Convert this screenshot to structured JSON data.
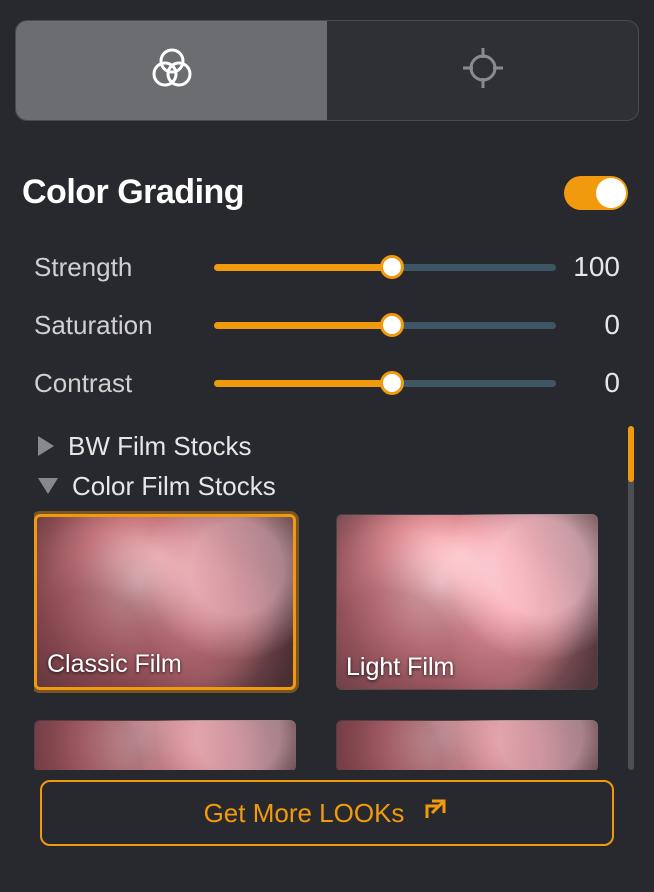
{
  "tabs": {
    "color_icon": "venn-icon",
    "target_icon": "target-icon"
  },
  "header": {
    "title": "Color Grading",
    "enabled": true
  },
  "sliders": [
    {
      "label": "Strength",
      "value": 100,
      "fill_pct": 52
    },
    {
      "label": "Saturation",
      "value": 0,
      "fill_pct": 52
    },
    {
      "label": "Contrast",
      "value": 0,
      "fill_pct": 52
    }
  ],
  "categories": [
    {
      "name": "BW Film Stocks",
      "expanded": false
    },
    {
      "name": "Color Film Stocks",
      "expanded": true
    }
  ],
  "presets": [
    {
      "label": "Classic Film",
      "selected": true,
      "variant": "classic"
    },
    {
      "label": "Light Film",
      "selected": false,
      "variant": "light"
    }
  ],
  "cta": {
    "label": "Get More LOOKs"
  },
  "colors": {
    "accent": "#f29a0e"
  }
}
